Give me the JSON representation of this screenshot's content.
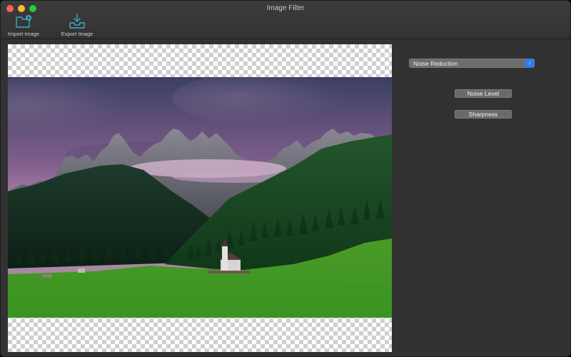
{
  "window": {
    "title": "Image Filter"
  },
  "toolbar": {
    "import": {
      "label": "Import Image",
      "icon": "folder-add-icon"
    },
    "export": {
      "label": "Export Image",
      "icon": "tray-download-icon"
    }
  },
  "filter_select": {
    "value": "Noise Reduction"
  },
  "buttons": {
    "noise_level": "Noise Level",
    "sharpness": "Sharpness"
  },
  "colors": {
    "accent": "#2f7cf6",
    "icon": "#3fa9c9"
  }
}
